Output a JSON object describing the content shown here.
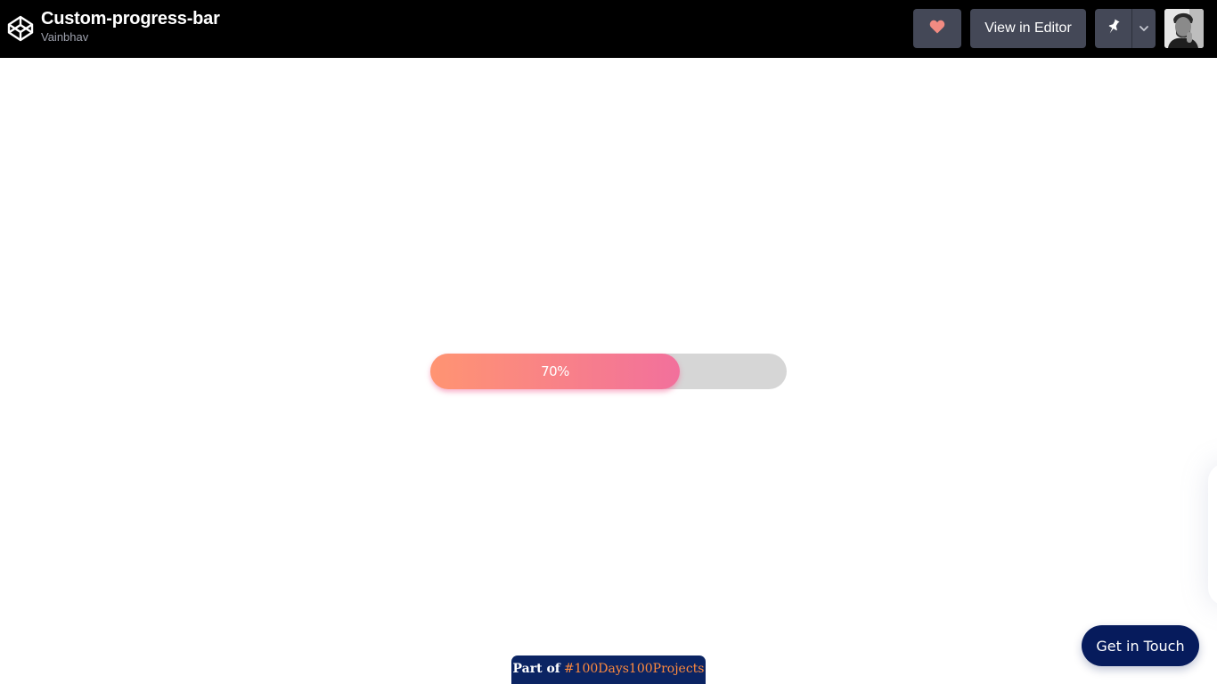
{
  "header": {
    "title": "Custom-progress-bar",
    "author": "Vainbhav",
    "view_in_editor_label": "View in Editor",
    "logo_icon": "codepen-logo-icon",
    "heart_icon": "heart-icon",
    "pin_icon": "pin-icon",
    "chevron_icon": "chevron-down-icon",
    "heart_color": "#f28b82"
  },
  "progress": {
    "value": 0.7,
    "label": "70%",
    "gradient_start": "#ff9472",
    "gradient_end": "#f2709c",
    "track_color": "#d6d6d6"
  },
  "badge": {
    "prefix": "Part of",
    "hashtag": "#100Days100Projects",
    "hashtag_color": "#ff8a3d",
    "background": "#0b2463"
  },
  "cta": {
    "label": "Get in Touch",
    "background": "#061b5c"
  }
}
